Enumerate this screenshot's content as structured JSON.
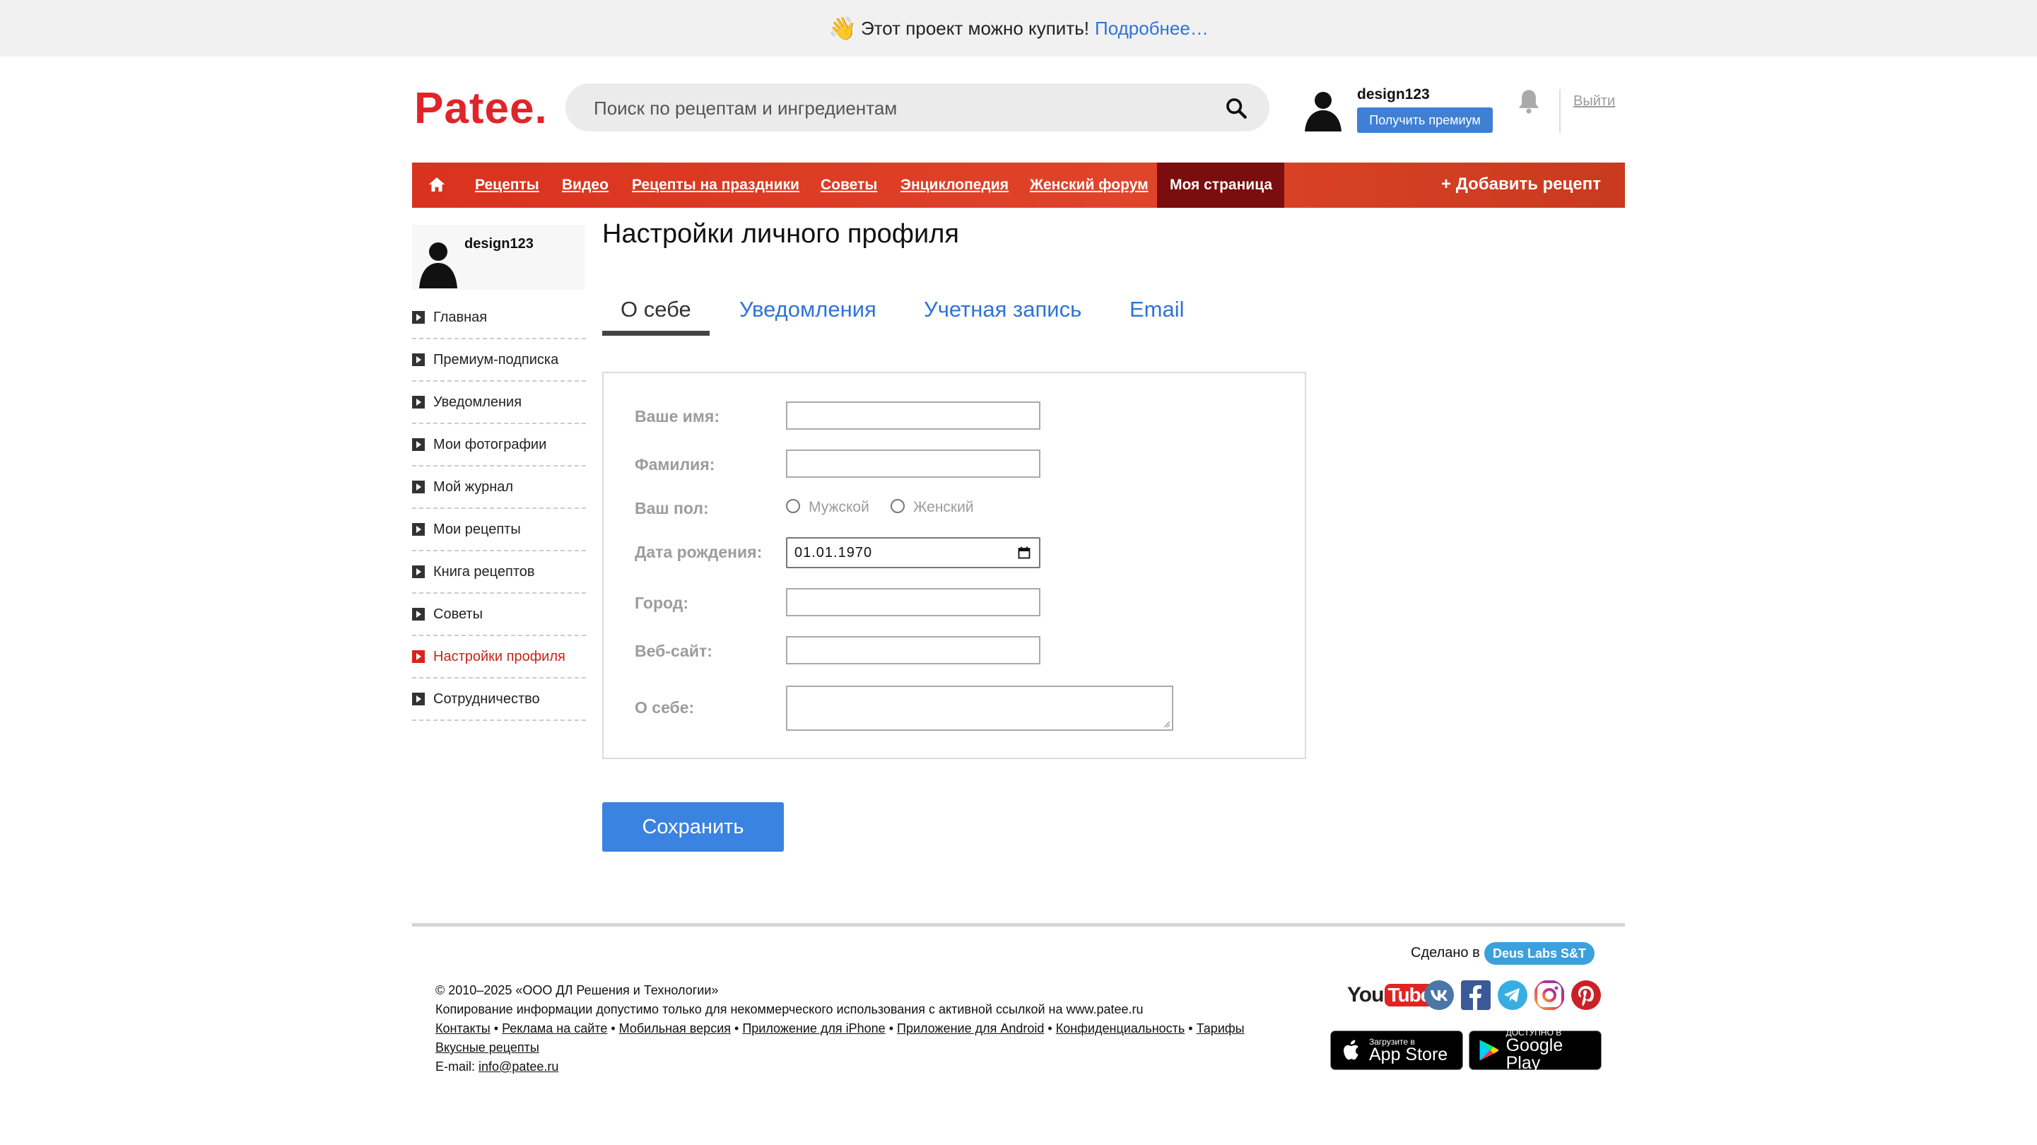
{
  "banner": {
    "emoji": "👋",
    "text": "Этот проект можно купить!",
    "link": "Подробнее…"
  },
  "header": {
    "logo": "Patee.",
    "search_placeholder": "Поиск по рецептам и ингредиентам",
    "username": "design123",
    "premium_button": "Получить премиум",
    "logout": "Выйти"
  },
  "nav": {
    "items": [
      "Рецепты",
      "Видео",
      "Рецепты на праздники",
      "Советы",
      "Энциклопедия",
      "Женский форум"
    ],
    "active": "Моя страница",
    "add_recipe": "+ Добавить рецепт"
  },
  "sidebar": {
    "username": "design123",
    "items": [
      {
        "label": "Главная"
      },
      {
        "label": "Премиум-подписка"
      },
      {
        "label": "Уведомления"
      },
      {
        "label": "Мои фотографии"
      },
      {
        "label": "Мой журнал"
      },
      {
        "label": "Мои рецепты"
      },
      {
        "label": "Книга рецептов"
      },
      {
        "label": "Советы"
      },
      {
        "label": "Настройки профиля",
        "active": true
      },
      {
        "label": "Сотрудничество"
      }
    ]
  },
  "main": {
    "title": "Настройки личного профиля",
    "tabs": [
      "О себе",
      "Уведомления",
      "Учетная запись",
      "Email"
    ],
    "active_tab": "О себе",
    "form": {
      "first_name_label": "Ваше имя:",
      "last_name_label": "Фамилия:",
      "gender_label": "Ваш пол:",
      "gender_male": "Мужской",
      "gender_female": "Женский",
      "birthdate_label": "Дата рождения:",
      "birthdate_value": "01.01.1970",
      "city_label": "Город:",
      "website_label": "Веб-сайт:",
      "about_label": "О себе:"
    },
    "save_button": "Сохранить"
  },
  "footer": {
    "made_in": "Сделано в",
    "made_in_badge": "Deus Labs S&T",
    "copyright": "© 2010–2025 «ООО ДЛ Решения и Технологии»",
    "copy_notice": "Копирование информации допустимо только для некоммерческого использования с активной ссылкой на www.patee.ru",
    "links": [
      "Контакты",
      "Реклама на сайте",
      "Мобильная версия",
      "Приложение для iPhone",
      "Приложение для Android",
      "Конфиденциальность",
      "Тарифы"
    ],
    "tasty_link": "Вкусные рецепты",
    "email_label": "E-mail:",
    "email": "info@patee.ru",
    "social": {
      "youtube_you": "You",
      "youtube_tube": "Tube"
    },
    "appstore_small": "Загрузите в",
    "appstore_big": "App Store",
    "googleplay_small": "ДОСТУПНО В",
    "googleplay_big": "Google Play"
  },
  "colors": {
    "brand_red": "#e0252a",
    "nav_red": "#d9321f",
    "nav_active": "#7a0d0d",
    "link_blue": "#2e73d8",
    "button_blue": "#3a83e0"
  }
}
